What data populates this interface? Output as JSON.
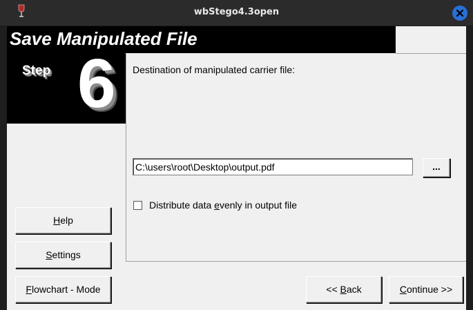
{
  "titlebar": {
    "title": "wbStego4.3open",
    "app_icon": "wine-glass-icon",
    "close_icon": "close-icon"
  },
  "header": {
    "title": "Save Manipulated File"
  },
  "step": {
    "word": "Step",
    "number": "6"
  },
  "main": {
    "destination_label": "Destination of manipulated carrier file:",
    "path_value": "C:\\users\\root\\Desktop\\output.pdf",
    "browse_label": "...",
    "distribute_label": "Distribute data evenly in output file",
    "distribute_checked": false
  },
  "buttons": {
    "help": "Help",
    "settings": "Settings",
    "flowchart": "Flowchart - Mode",
    "back": "<< Back",
    "continue": "Continue >>"
  },
  "colors": {
    "close_button": "#2a6fd6",
    "header_bg": "#000000",
    "window_bg": "#f0f0f0",
    "titlebar_bg": "#2b2b2b"
  }
}
